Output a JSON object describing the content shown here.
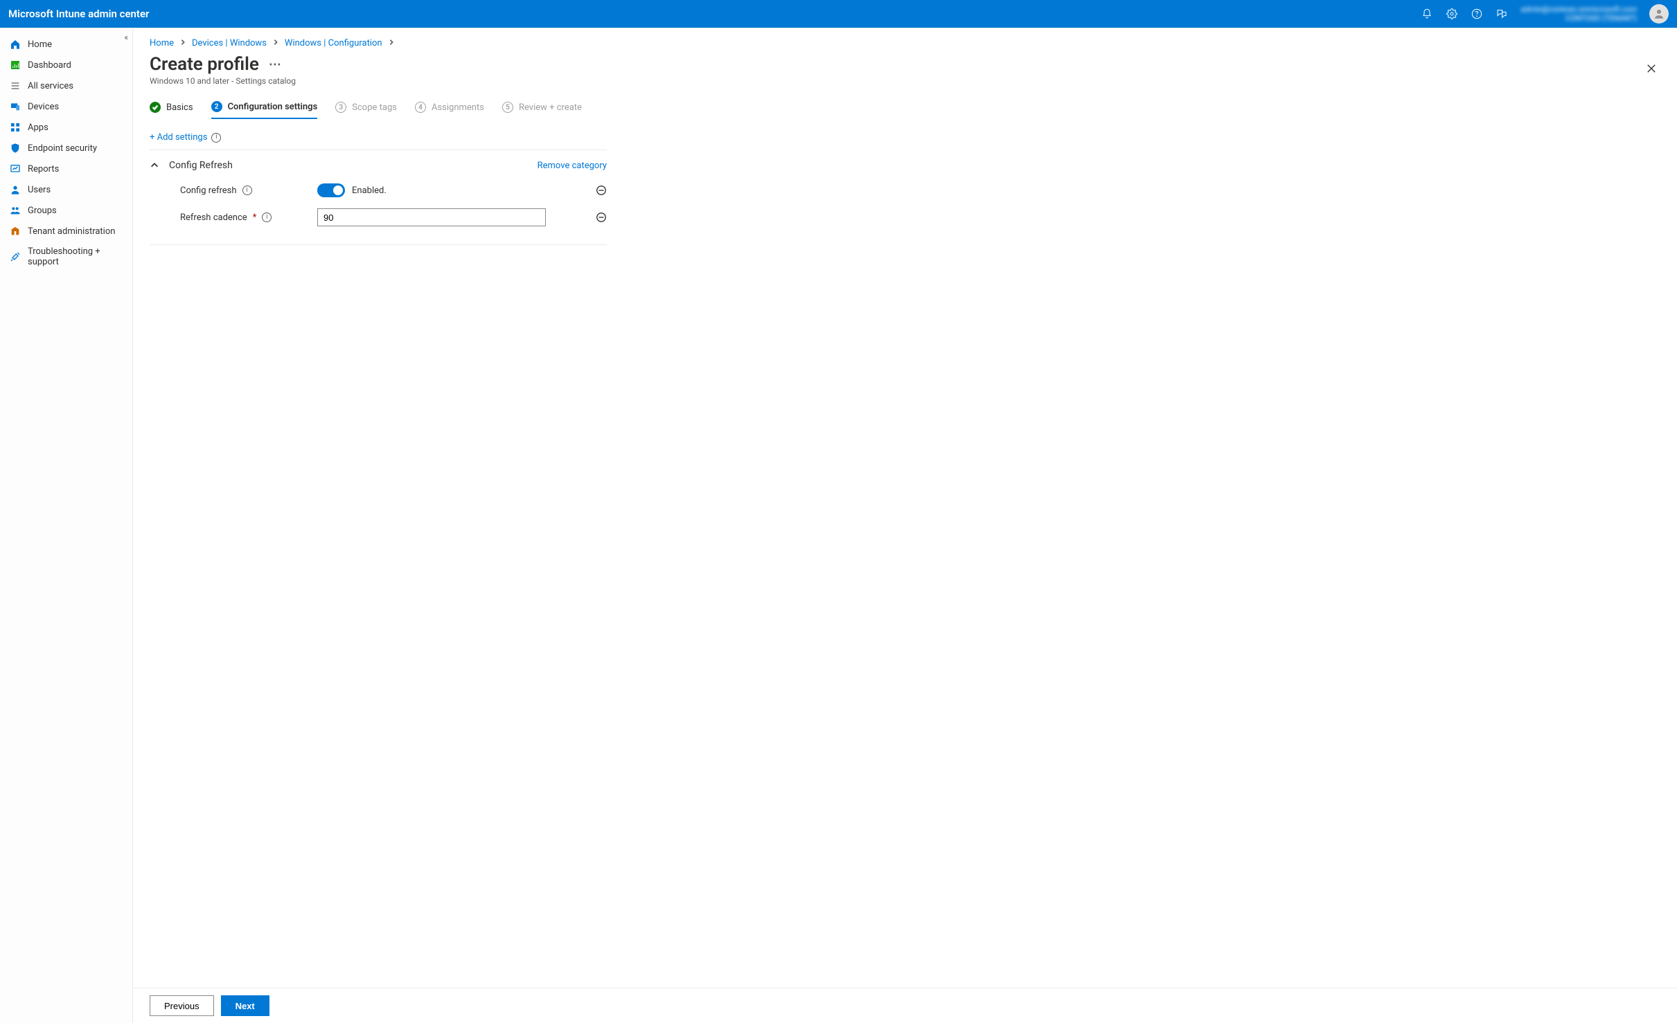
{
  "app_title": "Microsoft Intune admin center",
  "topbar": {
    "user_line1": "admin@contoso.onmicrosoft.com",
    "user_line2": "CONTOSO (TENANT)"
  },
  "sidebar": {
    "items": [
      {
        "label": "Home",
        "icon": "home"
      },
      {
        "label": "Dashboard",
        "icon": "dashboard"
      },
      {
        "label": "All services",
        "icon": "list"
      },
      {
        "label": "Devices",
        "icon": "devices"
      },
      {
        "label": "Apps",
        "icon": "apps"
      },
      {
        "label": "Endpoint security",
        "icon": "shield"
      },
      {
        "label": "Reports",
        "icon": "reports"
      },
      {
        "label": "Users",
        "icon": "user"
      },
      {
        "label": "Groups",
        "icon": "groups"
      },
      {
        "label": "Tenant administration",
        "icon": "tenant"
      },
      {
        "label": "Troubleshooting + support",
        "icon": "tools"
      }
    ]
  },
  "breadcrumb": [
    "Home",
    "Devices | Windows",
    "Windows | Configuration"
  ],
  "page": {
    "title": "Create profile",
    "subtitle": "Windows 10 and later - Settings catalog"
  },
  "steps": [
    {
      "num": "✓",
      "label": "Basics",
      "state": "done"
    },
    {
      "num": "2",
      "label": "Configuration settings",
      "state": "active"
    },
    {
      "num": "3",
      "label": "Scope tags",
      "state": "upcoming"
    },
    {
      "num": "4",
      "label": "Assignments",
      "state": "upcoming"
    },
    {
      "num": "5",
      "label": "Review + create",
      "state": "upcoming"
    }
  ],
  "add_settings_label": "+ Add settings",
  "category": {
    "title": "Config Refresh",
    "remove_label": "Remove category",
    "settings": [
      {
        "label": "Config refresh",
        "type": "toggle",
        "value_label": "Enabled."
      },
      {
        "label": "Refresh cadence",
        "required": true,
        "type": "text",
        "value": "90"
      }
    ]
  },
  "footer": {
    "previous": "Previous",
    "next": "Next"
  }
}
